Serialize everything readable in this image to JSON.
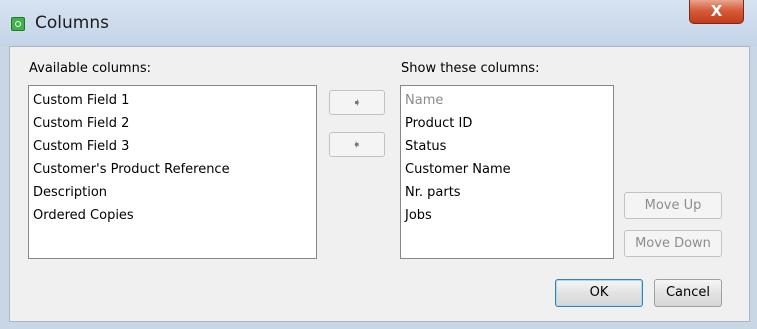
{
  "window": {
    "title": "Columns",
    "close_label": "X"
  },
  "available": {
    "label": "Available columns:",
    "items": [
      "Custom Field 1",
      "Custom Field 2",
      "Custom Field 3",
      "Customer's Product Reference",
      "Description",
      "Ordered Copies"
    ]
  },
  "shown": {
    "label": "Show these columns:",
    "items": [
      "Name",
      "Product ID",
      "Status",
      "Customer Name",
      "Nr. parts",
      "Jobs"
    ]
  },
  "arrows": {
    "add_icon": "arrow-right-icon",
    "remove_icon": "arrow-left-icon",
    "add_glyph": "➧",
    "remove_glyph": "➧"
  },
  "buttons": {
    "move_up": "Move Up",
    "move_down": "Move Down",
    "ok": "OK",
    "cancel": "Cancel"
  },
  "colors": {
    "frame": "#c9d6e6",
    "close_button": "#c23b1b",
    "panel": "#f0f0f0"
  }
}
